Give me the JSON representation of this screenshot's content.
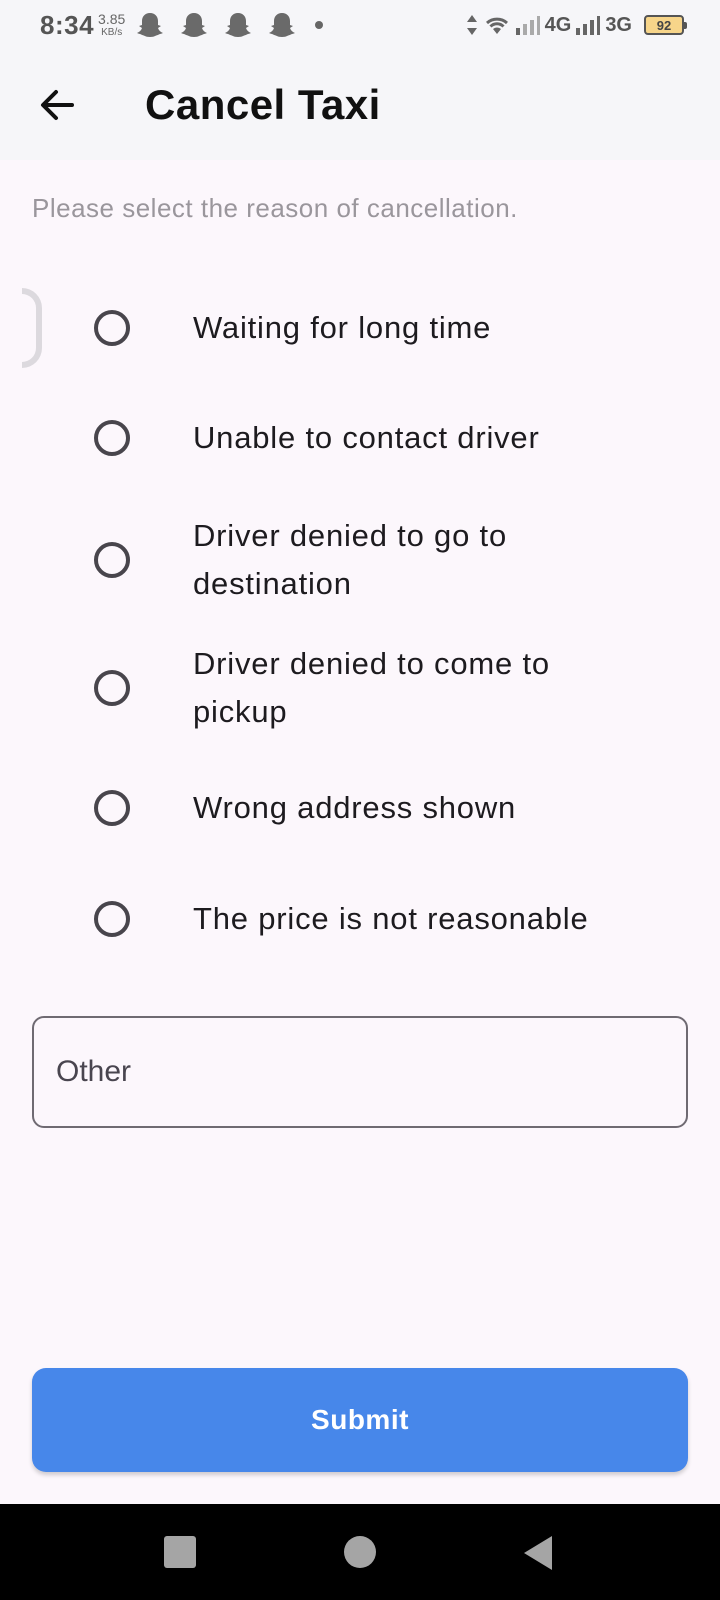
{
  "status_bar": {
    "time": "8:34",
    "speed_value": "3.85",
    "speed_unit": "KB/s",
    "notification_icons": [
      "snapchat-icon",
      "snapchat-icon",
      "snapchat-icon",
      "snapchat-icon"
    ],
    "network_1": "4G",
    "network_2": "3G",
    "battery": "92"
  },
  "app_bar": {
    "title": "Cancel Taxi",
    "back_icon": "arrow-left-icon"
  },
  "prompt": "Please select the reason of cancellation.",
  "reasons": [
    {
      "label": "Waiting for long time",
      "selected": false
    },
    {
      "label": "Unable to contact driver",
      "selected": false
    },
    {
      "label": "Driver denied to go to destination",
      "selected": false
    },
    {
      "label": "Driver denied to come to pickup",
      "selected": false
    },
    {
      "label": "Wrong address shown",
      "selected": false
    },
    {
      "label": "The price is not reasonable",
      "selected": false
    }
  ],
  "other_field": {
    "placeholder": "Other",
    "value": ""
  },
  "submit_label": "Submit",
  "colors": {
    "accent": "#4787ea",
    "background": "#fcf7fc",
    "app_bar": "#f6f6f9"
  }
}
